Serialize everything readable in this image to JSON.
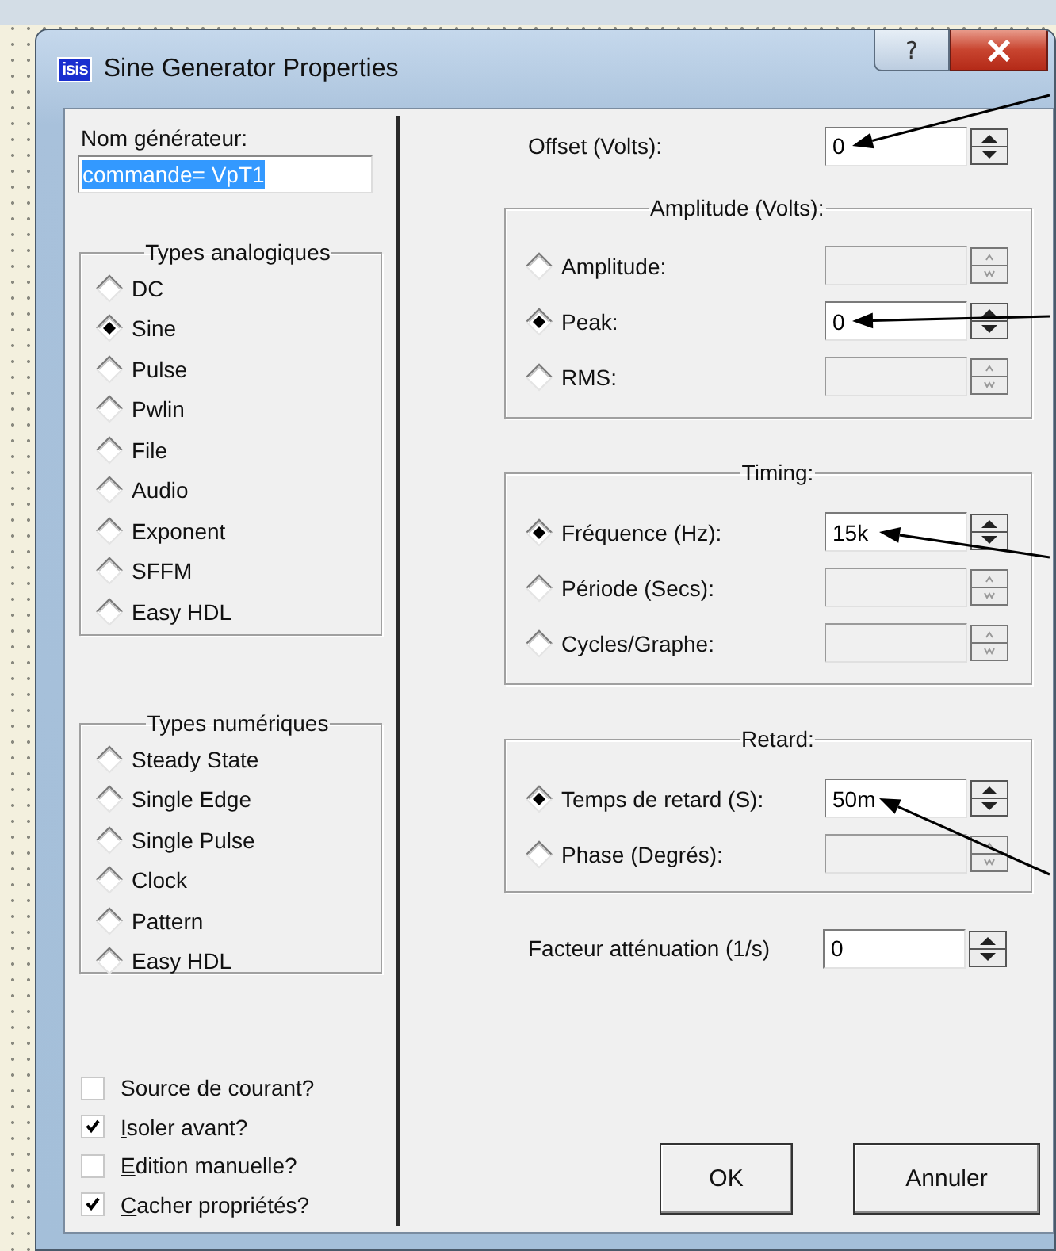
{
  "window": {
    "icon_text": "isis",
    "title": "Sine Generator Properties",
    "help": "?"
  },
  "name_field": {
    "label": "Nom générateur:",
    "value": "commande= VpT1",
    "highlighted": true
  },
  "analog_types": {
    "title": "Types analogiques",
    "options": [
      {
        "label": "DC",
        "selected": false
      },
      {
        "label": "Sine",
        "selected": true
      },
      {
        "label": "Pulse",
        "selected": false
      },
      {
        "label": "Pwlin",
        "selected": false
      },
      {
        "label": "File",
        "selected": false
      },
      {
        "label": "Audio",
        "selected": false
      },
      {
        "label": "Exponent",
        "selected": false
      },
      {
        "label": "SFFM",
        "selected": false
      },
      {
        "label": "Easy HDL",
        "selected": false
      }
    ]
  },
  "digital_types": {
    "title": "Types numériques",
    "options": [
      {
        "label": "Steady State",
        "selected": false
      },
      {
        "label": "Single Edge",
        "selected": false
      },
      {
        "label": "Single Pulse",
        "selected": false
      },
      {
        "label": "Clock",
        "selected": false
      },
      {
        "label": "Pattern",
        "selected": false
      },
      {
        "label": "Easy HDL",
        "selected": false
      }
    ]
  },
  "checkboxes": [
    {
      "label": "Source de courant?",
      "checked": false,
      "mnemonic": false
    },
    {
      "label": "Isoler avant?",
      "checked": true,
      "mnemonic": true
    },
    {
      "label": "Edition manuelle?",
      "checked": false,
      "mnemonic": true
    },
    {
      "label": "Cacher propriétés?",
      "checked": true,
      "mnemonic": true
    }
  ],
  "offset": {
    "label": "Offset (Volts):",
    "value": "0",
    "pointed": true
  },
  "groups": [
    {
      "title": "Amplitude (Volts):",
      "options": [
        {
          "label": "Amplitude:",
          "selected": false,
          "disabled": true,
          "pointed": false
        },
        {
          "label": "Peak:",
          "selected": true,
          "disabled": false,
          "value": "0",
          "pointed": true
        },
        {
          "label": "RMS:",
          "selected": false,
          "disabled": true,
          "pointed": false
        }
      ]
    },
    {
      "title": "Timing:",
      "options": [
        {
          "label": "Fréquence (Hz):",
          "selected": true,
          "disabled": false,
          "value": "15k",
          "pointed": true
        },
        {
          "label": "Période (Secs):",
          "selected": false,
          "disabled": true,
          "pointed": false
        },
        {
          "label": "Cycles/Graphe:",
          "selected": false,
          "disabled": true,
          "pointed": false
        }
      ]
    },
    {
      "title": "Retard:",
      "options": [
        {
          "label": "Temps de retard (S):",
          "selected": true,
          "disabled": false,
          "value": "50m",
          "pointed": true
        },
        {
          "label": "Phase (Degrés):",
          "selected": false,
          "disabled": true,
          "pointed": false
        }
      ]
    }
  ],
  "damping": {
    "label": "Facteur atténuation (1/s)",
    "value": "0",
    "pointed": false
  },
  "buttons": [
    "OK",
    "Annuler"
  ]
}
